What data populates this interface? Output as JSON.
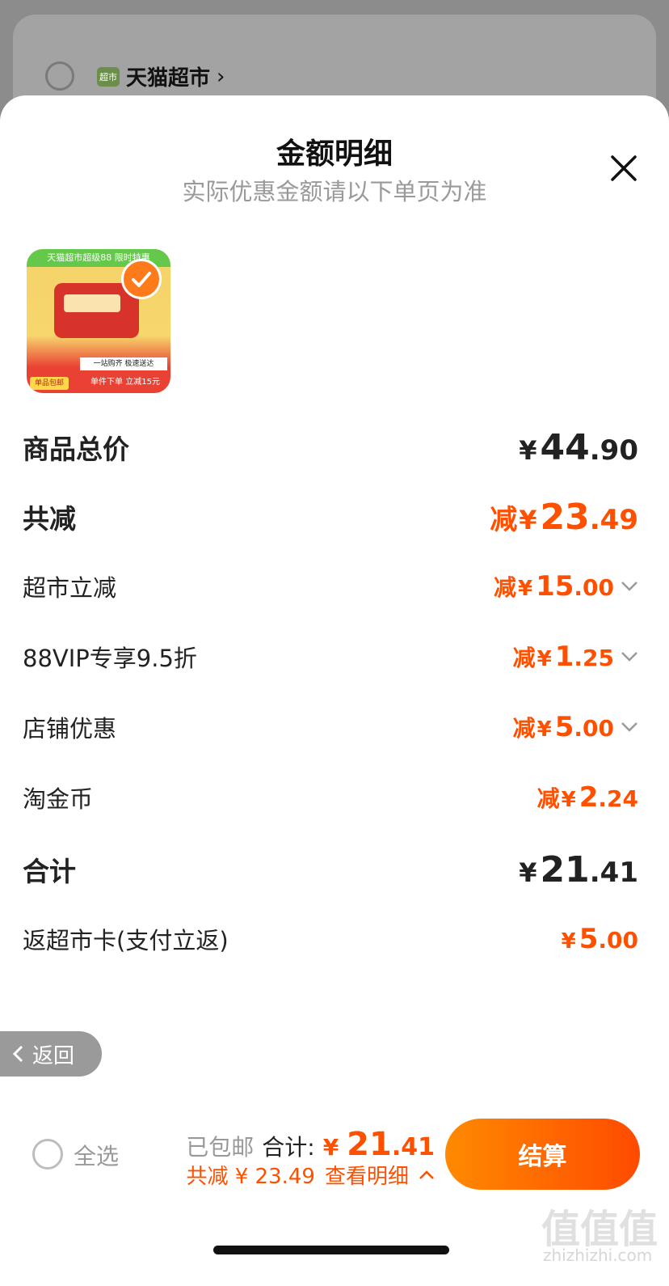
{
  "background": {
    "shop_logo": "超市",
    "shop_name": "天猫超市",
    "shop_chevron": "›"
  },
  "sheet": {
    "title": "金额明细",
    "subtitle": "实际优惠金额请以下单页为准",
    "close_icon": "close-icon"
  },
  "product": {
    "banner": "天猫超市超级88  限时特惠",
    "band_text": "一站购齐 极速送达",
    "bottom_text": "单件下单 立减15元",
    "tag": "单品包邮"
  },
  "rows": {
    "goods_total": {
      "label": "商品总价",
      "yen": "¥",
      "int": "44",
      "dec": ".90"
    },
    "total_discount": {
      "label": "共减",
      "prefix": "减",
      "yen": "¥",
      "int": "23",
      "dec": ".49"
    },
    "market_discount": {
      "label": "超市立减",
      "prefix": "减",
      "yen": "¥",
      "int": "15",
      "dec": ".00"
    },
    "vip_discount": {
      "label": "88VIP专享9.5折",
      "prefix": "减",
      "yen": "¥",
      "int": "1",
      "dec": ".25"
    },
    "store_discount": {
      "label": "店铺优惠",
      "prefix": "减",
      "yen": "¥",
      "int": "5",
      "dec": ".00"
    },
    "coins": {
      "label": "淘金币",
      "prefix": "减",
      "yen": "¥",
      "int": "2",
      "dec": ".24"
    },
    "sum": {
      "label": "合计",
      "yen": "¥",
      "int": "21",
      "dec": ".41"
    },
    "cashback": {
      "label": "返超市卡(支付立返)",
      "yen": "¥",
      "int": "5",
      "dec": ".00"
    }
  },
  "back_button": {
    "label": "返回"
  },
  "bottom_bar": {
    "select_all": "全选",
    "free_shipping": "已包邮",
    "total_label": "合计:",
    "total_yen": "¥",
    "total_int": "21",
    "total_dec": ".41",
    "discount_text": "共减 ¥ 23.49",
    "detail_link": "查看明细",
    "checkout": "结算"
  },
  "watermark": {
    "text": "值值值",
    "url": "zhizhizhi.com"
  },
  "colors": {
    "accent": "#ff5000",
    "gradient_start": "#ff8a00",
    "gradient_end": "#ff4a00"
  }
}
